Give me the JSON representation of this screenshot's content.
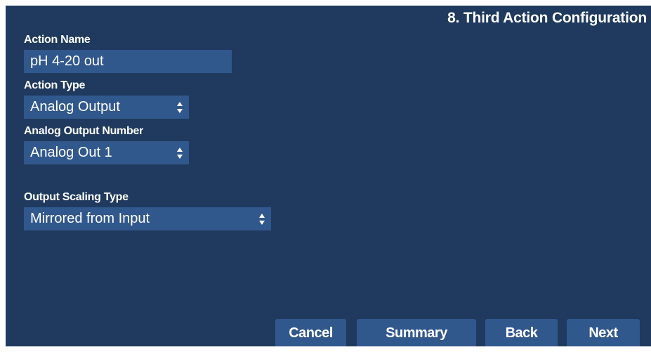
{
  "header": {
    "title": "8. Third Action Configuration"
  },
  "form": {
    "action_name": {
      "label": "Action Name",
      "value": "pH 4-20 out"
    },
    "action_type": {
      "label": "Action Type",
      "selected": "Analog Output"
    },
    "analog_output_number": {
      "label": "Analog Output Number",
      "selected": "Analog Out 1"
    },
    "output_scaling_type": {
      "label": "Output Scaling Type",
      "selected": "Mirrored from Input"
    }
  },
  "footer": {
    "cancel_label": "Cancel",
    "summary_label": "Summary",
    "back_label": "Back",
    "next_label": "Next"
  },
  "colors": {
    "panel_background": "#1f3a5e",
    "control_background": "#31588d",
    "text": "#ffffff"
  },
  "icons": {
    "select_arrows": "up-down-arrows-icon"
  }
}
